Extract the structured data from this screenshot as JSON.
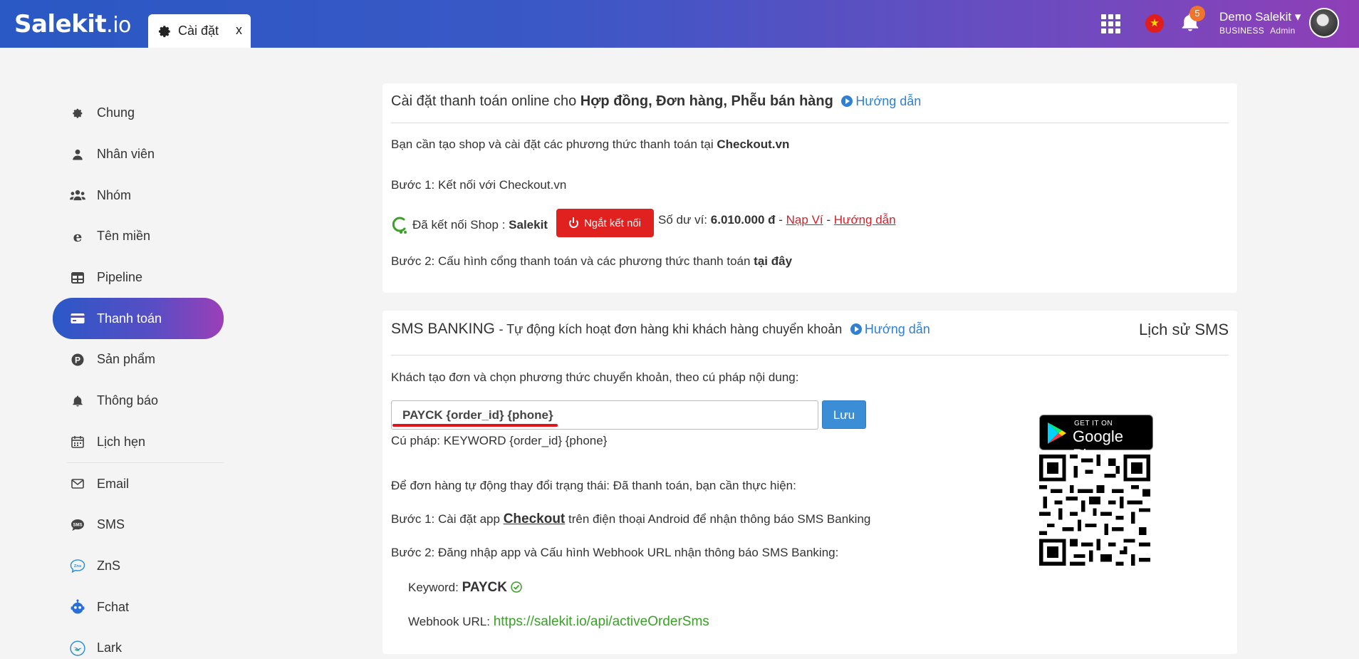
{
  "topbar": {
    "logo_main": "Salekit",
    "logo_suffix": ".io",
    "tab_label": "Cài đặt",
    "tab_close": "x",
    "notification_count": "5",
    "user_name": "Demo Salekit",
    "user_plan": "BUSINESS",
    "user_role": "Admin",
    "brand_gradient": [
      "#2a58c4",
      "#8f3fb7"
    ]
  },
  "sidebar": {
    "items": [
      {
        "label": "Chung",
        "icon": "gear-icon"
      },
      {
        "label": "Nhân viên",
        "icon": "user-icon"
      },
      {
        "label": "Nhóm",
        "icon": "users-icon"
      },
      {
        "label": "Tên miền",
        "icon": "domain-icon"
      },
      {
        "label": "Pipeline",
        "icon": "table-icon"
      },
      {
        "label": "Thanh toán",
        "icon": "credit-card-icon",
        "active": true
      },
      {
        "label": "Sản phẩm",
        "icon": "product-icon"
      },
      {
        "label": "Thông báo",
        "icon": "bell-icon"
      },
      {
        "label": "Lịch hẹn",
        "icon": "calendar-icon"
      },
      {
        "label": "Email",
        "icon": "mail-icon"
      },
      {
        "label": "SMS",
        "icon": "sms-icon"
      },
      {
        "label": "ZnS",
        "icon": "zns-icon"
      },
      {
        "label": "Fchat",
        "icon": "bot-icon"
      },
      {
        "label": "Lark",
        "icon": "lark-icon"
      }
    ]
  },
  "payment": {
    "title_prefix": "Cài đặt thanh toán online cho",
    "title_bold": "Hợp đồng, Đơn hàng, Phễu bán hàng",
    "guide_label": "Hướng dẫn",
    "intro_prefix": "Bạn cần tạo shop và cài đặt các phương thức thanh toán tại",
    "intro_bold": "Checkout.vn",
    "step1": "Bước 1: Kết nối với Checkout.vn",
    "connected_prefix": "Đã kết nối Shop :",
    "connected_shop": "Salekit",
    "disconnect_button": "Ngắt kết nối",
    "balance_prefix": "Số dư ví:",
    "balance_value": "6.010.000 đ",
    "dash1": "-",
    "topup_link": "Nạp Ví",
    "dash2": "-",
    "balance_guide_link": "Hướng dẫn",
    "step2_prefix": "Bước 2: Cấu hình cổng thanh toán và các phương thức thanh toán",
    "step2_bold": "tại đây"
  },
  "sms": {
    "title": "SMS BANKING",
    "subtitle": "- Tự động kích hoạt đơn hàng khi khách hàng chuyển khoản",
    "guide_label": "Hướng dẫn",
    "history_label": "Lịch sử SMS",
    "instruction": "Khách tạo đơn và chọn phương thức chuyển khoản, theo cú pháp nội dung:",
    "syntax_value": "PAYCK {order_id} {phone}",
    "save_button": "Lưu",
    "syntax_hint": "Cú pháp: KEYWORD {order_id} {phone}",
    "auto_status_text": "Để đơn hàng tự động thay đổi trạng thái: Đã thanh toán, bạn cần thực hiện:",
    "step1_prefix": "Bước 1: Cài đặt app",
    "step1_link": "Checkout",
    "step1_suffix": "trên điện thoại Android để nhận thông báo SMS Banking",
    "step2": "Bước 2: Đăng nhập app và Cấu hình Webhook URL nhận thông báo SMS Banking:",
    "keyword_label": "Keyword:",
    "keyword_value": "PAYCK",
    "webhook_label": "Webhook URL:",
    "webhook_value": "https://salekit.io/api/activeOrderSms",
    "store_badge_small": "GET IT ON",
    "store_badge_large": "Google Play"
  }
}
